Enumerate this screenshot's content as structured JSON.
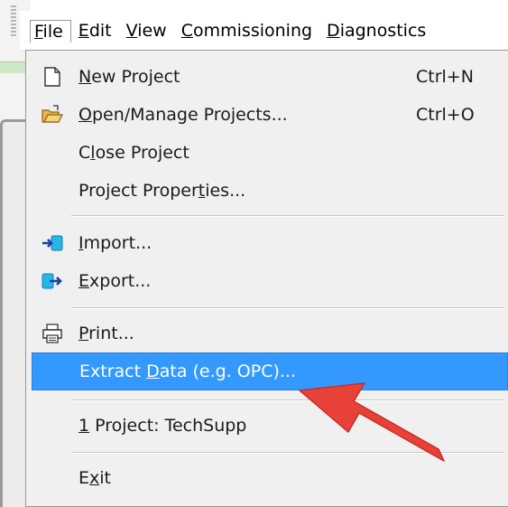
{
  "menubar": {
    "items": [
      {
        "mnemonic": "F",
        "rest": "ile"
      },
      {
        "mnemonic": "E",
        "rest": "dit"
      },
      {
        "mnemonic": "V",
        "rest": "iew"
      },
      {
        "mnemonic": "C",
        "rest": "ommissioning"
      },
      {
        "mnemonic": "D",
        "rest": "iagnostics"
      }
    ]
  },
  "file_menu": {
    "new_project": {
      "pre": "",
      "mn": "N",
      "post": "ew Project",
      "shortcut": "Ctrl+N"
    },
    "open_projects": {
      "pre": "",
      "mn": "O",
      "post": "pen/Manage Projects...",
      "shortcut": "Ctrl+O"
    },
    "close_project": {
      "pre": "C",
      "mn": "l",
      "post": "ose Project"
    },
    "project_properties": {
      "pre": "Project Proper",
      "mn": "t",
      "post": "ies..."
    },
    "import": {
      "pre": "",
      "mn": "I",
      "post": "mport..."
    },
    "export": {
      "pre": "",
      "mn": "E",
      "post": "xport..."
    },
    "print": {
      "pre": "",
      "mn": "P",
      "post": "rint..."
    },
    "extract_data": {
      "pre": "Extract ",
      "mn": "D",
      "post": "ata (e.g. OPC)..."
    },
    "recent_1": {
      "pre": "",
      "mn": "1",
      "post": " Project: TechSupp"
    },
    "exit": {
      "pre": "E",
      "mn": "x",
      "post": "it"
    }
  },
  "colors": {
    "highlight": "#3399ff",
    "arrow": "#e8413a"
  },
  "icons": [
    "new-document-icon",
    "open-folder-icon",
    "import-icon",
    "export-icon",
    "printer-icon",
    "arrow-annotation"
  ]
}
